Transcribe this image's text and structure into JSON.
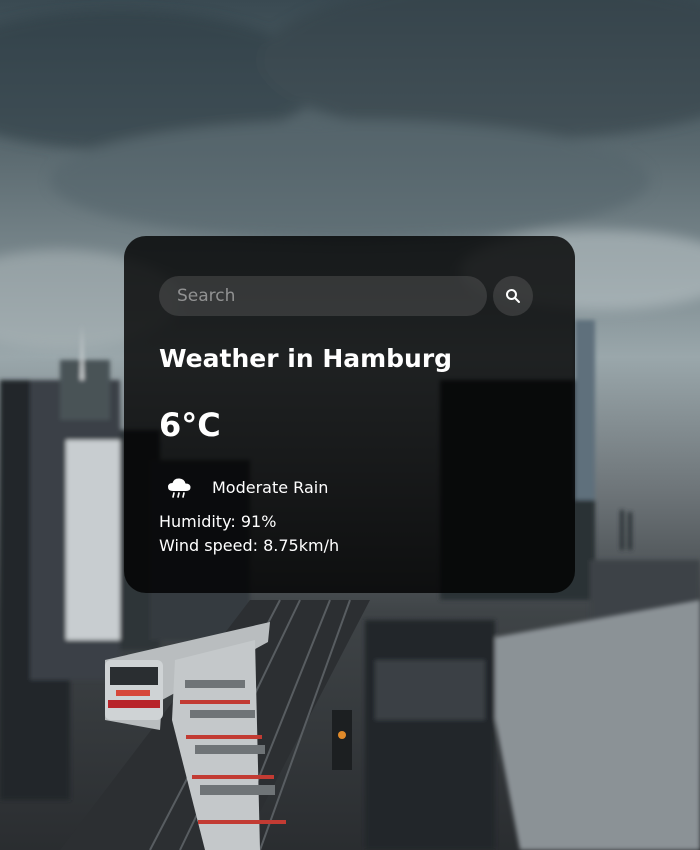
{
  "search": {
    "placeholder": "Search",
    "value": "",
    "button_icon": "search-icon"
  },
  "weather": {
    "title": "Weather in Hamburg",
    "temperature": "6°C",
    "condition_icon": "rain-cloud-icon",
    "condition": "Moderate Rain",
    "humidity": "Humidity: 91%",
    "wind": "Wind speed: 8.75km/h"
  },
  "colors": {
    "card_background": "#000000",
    "text": "#ffffff",
    "input_background": "#7d7d7d"
  }
}
